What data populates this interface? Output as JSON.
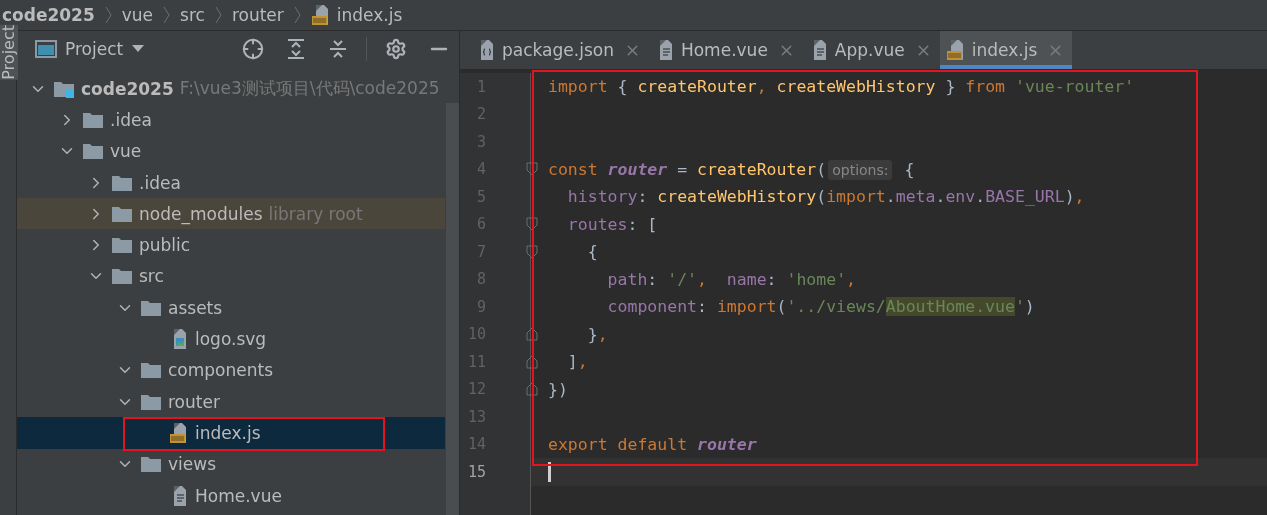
{
  "breadcrumbs": [
    {
      "label": "code2025",
      "kind": "root"
    },
    {
      "label": "vue",
      "kind": "folder"
    },
    {
      "label": "src",
      "kind": "folder"
    },
    {
      "label": "router",
      "kind": "folder"
    },
    {
      "label": "index.js",
      "kind": "js"
    }
  ],
  "tool_stripe": {
    "label": "Project"
  },
  "project_panel": {
    "title": "Project"
  },
  "tree": [
    {
      "label": "code2025",
      "path": "F:\\vue3测试项目\\代码\\code2025",
      "kind": "module",
      "expanded": true,
      "selected": false,
      "children": [
        {
          "label": ".idea",
          "kind": "folder",
          "expanded": false,
          "selected": false
        },
        {
          "label": "vue",
          "kind": "folder",
          "expanded": true,
          "selected": false,
          "children": [
            {
              "label": ".idea",
              "kind": "folder",
              "expanded": false,
              "selected": false
            },
            {
              "label": "node_modules",
              "hint": "library root",
              "kind": "library",
              "expanded": false,
              "selected": false
            },
            {
              "label": "public",
              "kind": "folder",
              "expanded": false,
              "selected": false
            },
            {
              "label": "src",
              "kind": "folder",
              "expanded": true,
              "selected": false,
              "children": [
                {
                  "label": "assets",
                  "kind": "folder",
                  "expanded": true,
                  "selected": false,
                  "children": [
                    {
                      "label": "logo.svg",
                      "kind": "image",
                      "selected": false
                    }
                  ]
                },
                {
                  "label": "components",
                  "kind": "folder",
                  "expanded": true,
                  "selected": false
                },
                {
                  "label": "router",
                  "kind": "folder",
                  "expanded": true,
                  "selected": false,
                  "children": [
                    {
                      "label": "index.js",
                      "kind": "js",
                      "selected": true
                    }
                  ]
                },
                {
                  "label": "views",
                  "kind": "folder",
                  "expanded": true,
                  "selected": false,
                  "children": [
                    {
                      "label": "Home.vue",
                      "kind": "text",
                      "selected": false
                    }
                  ]
                }
              ]
            }
          ]
        }
      ]
    }
  ],
  "tabs": [
    {
      "label": "package.json",
      "kind": "json",
      "selected": false
    },
    {
      "label": "Home.vue",
      "kind": "text",
      "selected": false
    },
    {
      "label": "App.vue",
      "kind": "text",
      "selected": false
    },
    {
      "label": "index.js",
      "kind": "js",
      "selected": true
    }
  ],
  "code_lines": [
    {
      "number": "1",
      "tokens": [
        {
          "kind": "keyword",
          "t": "import"
        },
        {
          "kind": "plain",
          "t": " { "
        },
        {
          "kind": "function",
          "t": "createRouter"
        },
        {
          "kind": "keyword",
          "t": ", "
        },
        {
          "kind": "function",
          "t": "createWebHistory"
        },
        {
          "kind": "plain",
          "t": " } "
        },
        {
          "kind": "keyword",
          "t": "from "
        },
        {
          "kind": "string",
          "t": "'vue-router'"
        }
      ]
    },
    {
      "number": "2"
    },
    {
      "number": "3"
    },
    {
      "number": "4",
      "fold_start": true,
      "tokens": [
        {
          "kind": "keyword",
          "t": "const "
        },
        {
          "kind": "variable",
          "t": "router"
        },
        {
          "kind": "plain",
          "t": " = "
        },
        {
          "kind": "function",
          "t": "createRouter"
        },
        {
          "kind": "plain",
          "t": "("
        },
        {
          "kind": "hint",
          "t": "options:"
        },
        {
          "kind": "plain",
          "t": " {"
        }
      ]
    },
    {
      "number": "5",
      "tokens": [
        {
          "kind": "property",
          "t": "  history"
        },
        {
          "kind": "plain",
          "t": ": "
        },
        {
          "kind": "function",
          "t": "createWebHistory"
        },
        {
          "kind": "plain",
          "t": "("
        },
        {
          "kind": "keyword",
          "t": "import"
        },
        {
          "kind": "plain",
          "t": "."
        },
        {
          "kind": "property",
          "t": "meta"
        },
        {
          "kind": "plain",
          "t": "."
        },
        {
          "kind": "property",
          "t": "env"
        },
        {
          "kind": "plain",
          "t": "."
        },
        {
          "kind": "property",
          "t": "BASE_URL"
        },
        {
          "kind": "plain",
          "t": ")"
        },
        {
          "kind": "keyword",
          "t": ","
        }
      ]
    },
    {
      "number": "6",
      "fold_start": true,
      "tokens": [
        {
          "kind": "property",
          "t": "  routes"
        },
        {
          "kind": "plain",
          "t": ": ["
        }
      ]
    },
    {
      "number": "7",
      "fold_start": true,
      "tokens": [
        {
          "kind": "plain",
          "t": "    {"
        }
      ]
    },
    {
      "number": "8",
      "tokens": [
        {
          "kind": "property",
          "t": "      path"
        },
        {
          "kind": "plain",
          "t": ": "
        },
        {
          "kind": "string",
          "t": "'/'"
        },
        {
          "kind": "keyword",
          "t": ",  "
        },
        {
          "kind": "property",
          "t": "name"
        },
        {
          "kind": "plain",
          "t": ": "
        },
        {
          "kind": "string",
          "t": "'home'"
        },
        {
          "kind": "keyword",
          "t": ","
        }
      ]
    },
    {
      "number": "9",
      "tokens": [
        {
          "kind": "property",
          "t": "      component"
        },
        {
          "kind": "plain",
          "t": ": "
        },
        {
          "kind": "keyword",
          "t": "import"
        },
        {
          "kind": "plain",
          "t": "("
        },
        {
          "kind": "string",
          "t": "'../views/"
        },
        {
          "kind": "match",
          "t": "AboutHome.vue"
        },
        {
          "kind": "string",
          "t": "'"
        },
        {
          "kind": "plain",
          "t": ")"
        }
      ]
    },
    {
      "number": "10",
      "fold_end": true,
      "tokens": [
        {
          "kind": "plain",
          "t": "    }"
        },
        {
          "kind": "keyword",
          "t": ","
        }
      ]
    },
    {
      "number": "11",
      "fold_end": true,
      "tokens": [
        {
          "kind": "plain",
          "t": "  ]"
        },
        {
          "kind": "keyword",
          "t": ","
        }
      ]
    },
    {
      "number": "12",
      "fold_end": true,
      "tokens": [
        {
          "kind": "plain",
          "t": "})"
        }
      ]
    },
    {
      "number": "13"
    },
    {
      "number": "14",
      "tokens": [
        {
          "kind": "keyword",
          "t": "export default "
        },
        {
          "kind": "variable",
          "t": "router"
        }
      ]
    },
    {
      "number": "15",
      "current": true
    }
  ]
}
